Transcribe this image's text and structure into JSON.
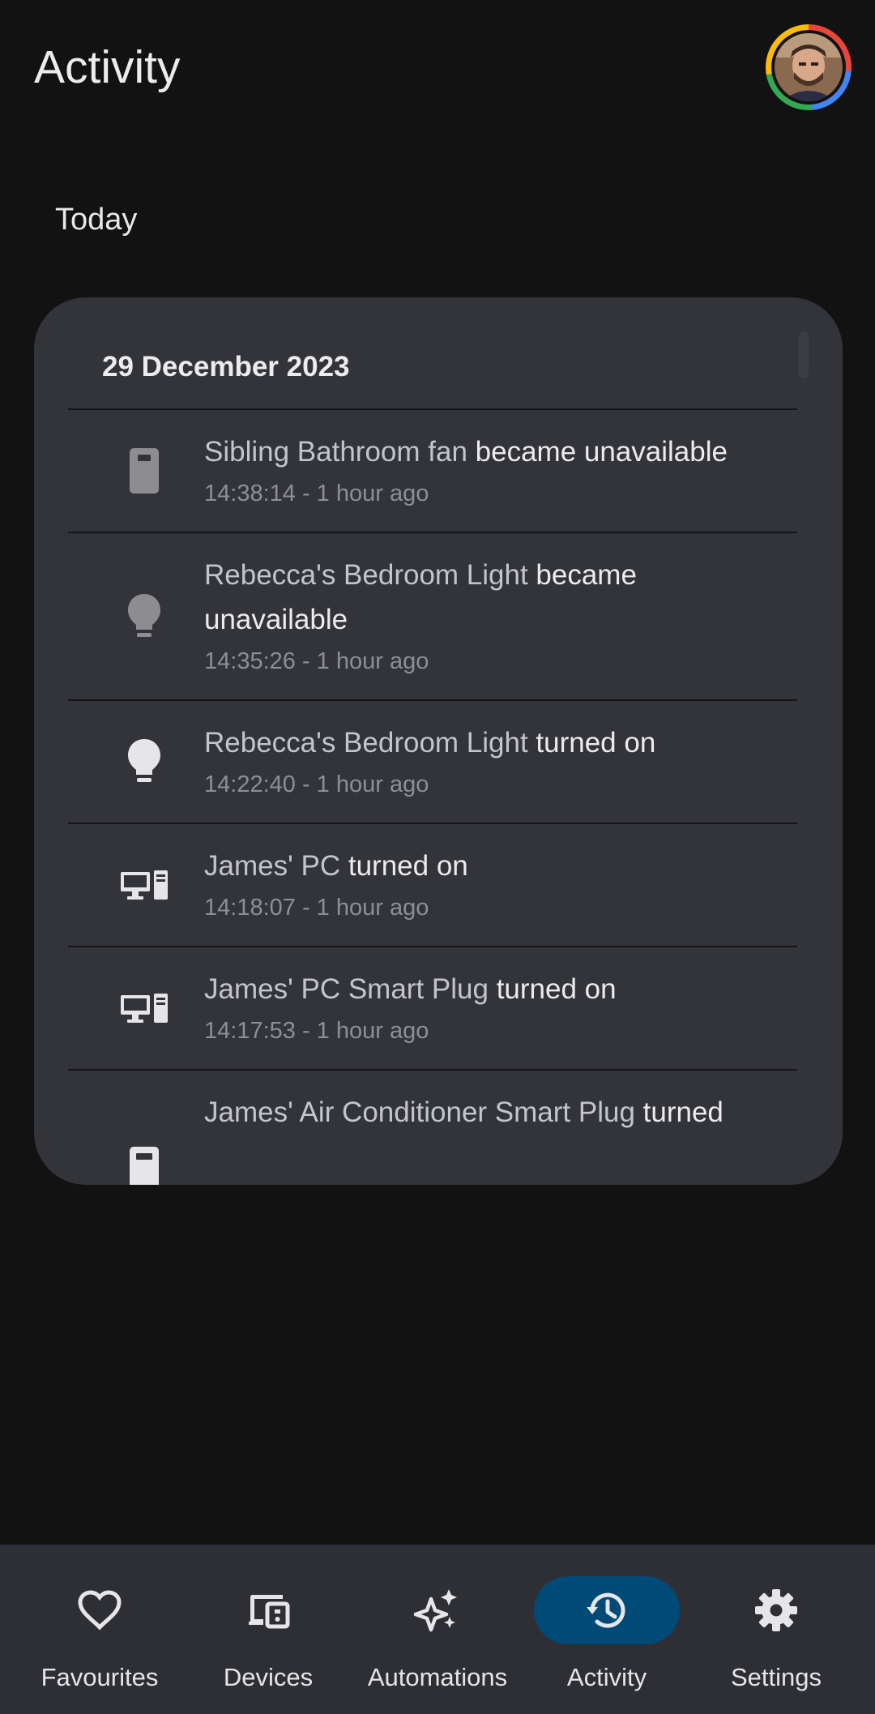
{
  "header": {
    "title": "Activity"
  },
  "section": {
    "label": "Today"
  },
  "card": {
    "date": "29 December 2023",
    "events": [
      {
        "icon": "fan-device-icon",
        "entity": "Sibling Bathroom fan",
        "action": " became unavailable",
        "time": "14:38:14 - 1 hour ago"
      },
      {
        "icon": "lightbulb-icon",
        "entity": "Rebecca's Bedroom Light",
        "action": " became unavailable",
        "time": "14:35:26 - 1 hour ago"
      },
      {
        "icon": "lightbulb-icon",
        "entity": "Rebecca's Bedroom Light",
        "action": " turned on",
        "time": "14:22:40 - 1 hour ago"
      },
      {
        "icon": "desktop-tower-icon",
        "entity": "James' PC",
        "action": " turned on",
        "time": "14:18:07 - 1 hour ago"
      },
      {
        "icon": "desktop-tower-icon",
        "entity": "James' PC Smart Plug",
        "action": " turned on",
        "time": "14:17:53 - 1 hour ago"
      },
      {
        "icon": "air-conditioner-icon",
        "entity": "James' Air Conditioner Smart Plug",
        "action": " turned",
        "time": ""
      }
    ]
  },
  "nav": {
    "items": [
      {
        "label": "Favourites",
        "icon": "heart-icon",
        "active": false
      },
      {
        "label": "Devices",
        "icon": "devices-icon",
        "active": false
      },
      {
        "label": "Automations",
        "icon": "sparkle-icon",
        "active": false
      },
      {
        "label": "Activity",
        "icon": "history-icon",
        "active": true
      },
      {
        "label": "Settings",
        "icon": "gear-icon",
        "active": false
      }
    ]
  },
  "colors": {
    "background": "#121212",
    "card": "#333439",
    "nav_background": "#2e2f34",
    "active_pill": "#004a77"
  }
}
